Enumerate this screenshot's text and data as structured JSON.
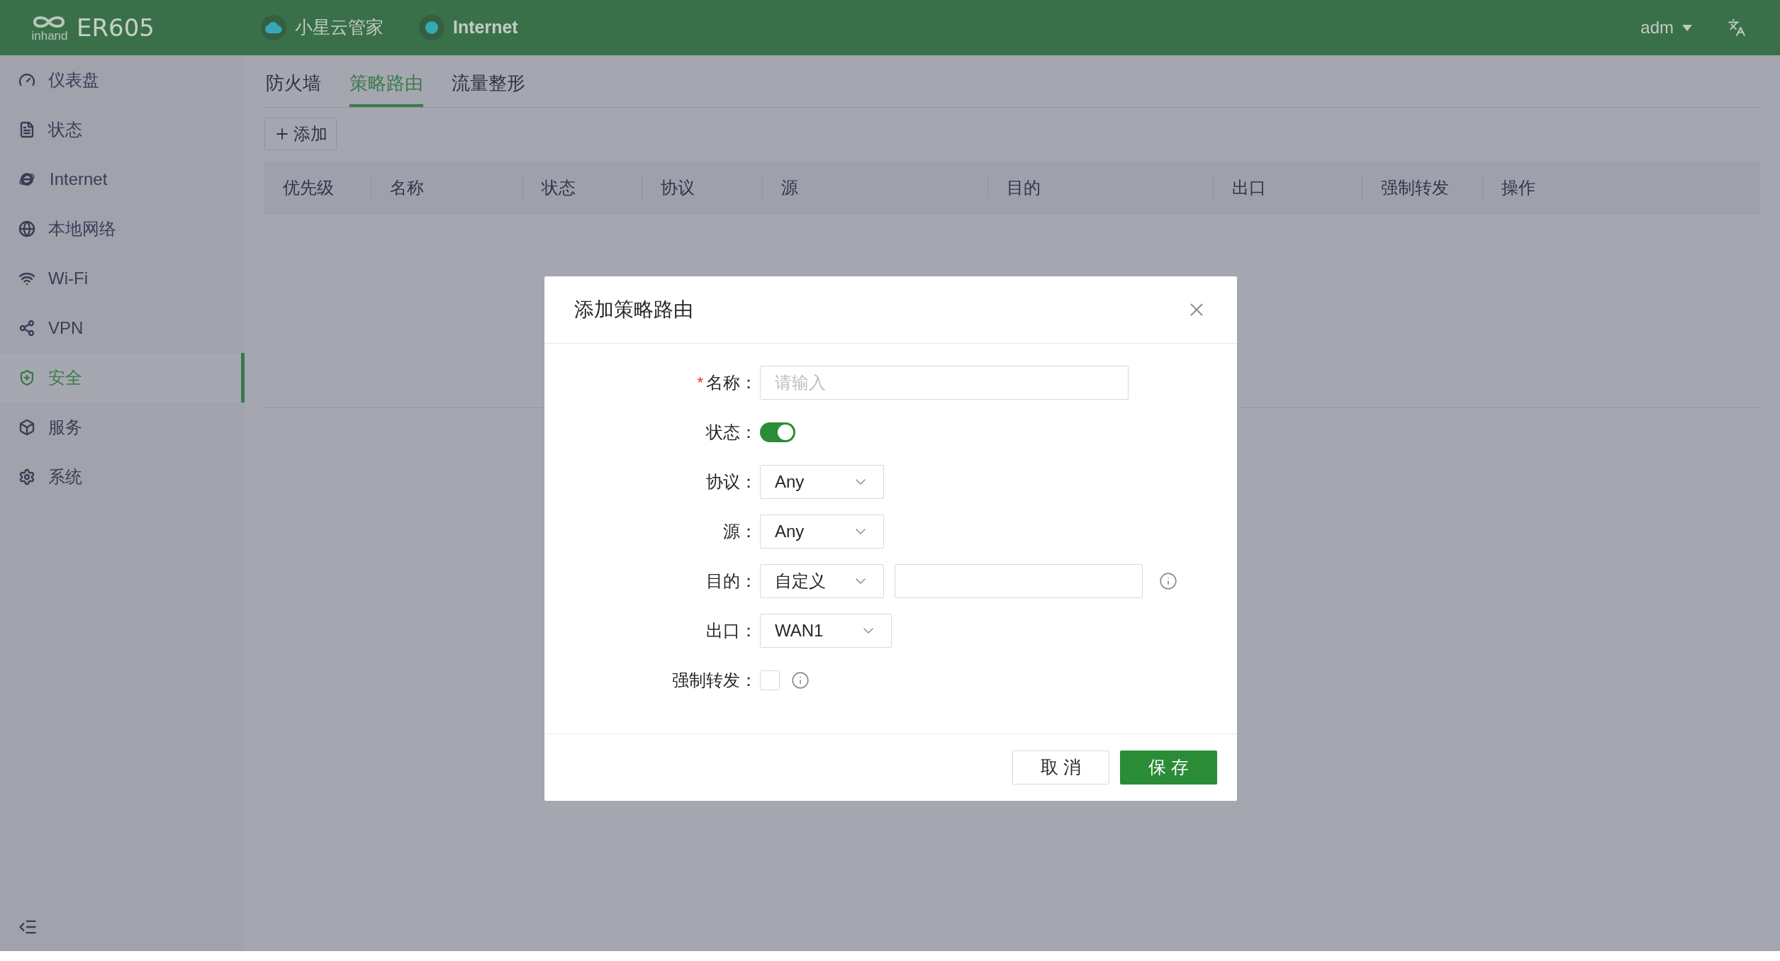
{
  "topbar": {
    "brand": "inhand",
    "model": "ER605",
    "status": [
      {
        "kind": "cloud",
        "label": "小星云管家"
      },
      {
        "kind": "dot",
        "label": "Internet"
      }
    ],
    "user": "adm"
  },
  "sidebar": {
    "items": [
      {
        "kind": "gauge",
        "label": "仪表盘",
        "selected": false
      },
      {
        "kind": "doc",
        "label": "状态",
        "selected": false
      },
      {
        "kind": "ie",
        "label": "Internet",
        "selected": false
      },
      {
        "kind": "globe",
        "label": "本地网络",
        "selected": false
      },
      {
        "kind": "wifi",
        "label": "Wi-Fi",
        "selected": false
      },
      {
        "kind": "vpn",
        "label": "VPN",
        "selected": false
      },
      {
        "kind": "shield",
        "label": "安全",
        "selected": true
      },
      {
        "kind": "box",
        "label": "服务",
        "selected": false
      },
      {
        "kind": "gear",
        "label": "系统",
        "selected": false
      }
    ]
  },
  "tabs": [
    {
      "label": "防火墙",
      "selected": false
    },
    {
      "label": "策略路由",
      "selected": true
    },
    {
      "label": "流量整形",
      "selected": false
    }
  ],
  "add_button": "添加",
  "table": {
    "columns": [
      "优先级",
      "名称",
      "状态",
      "协议",
      "源",
      "目的",
      "出口",
      "强制转发",
      "操作"
    ]
  },
  "dialog": {
    "title": "添加策略路由",
    "fields": [
      {
        "kind": "text",
        "label": "名称：",
        "required_mark": "*",
        "placeholder": "请输入"
      },
      {
        "kind": "switch",
        "label": "状态：",
        "on": true
      },
      {
        "kind": "select",
        "label": "协议：",
        "value": "Any"
      },
      {
        "kind": "select",
        "label": "源：",
        "value": "Any"
      },
      {
        "kind": "select_input",
        "label": "目的：",
        "value": "自定义"
      },
      {
        "kind": "select",
        "label": "出口：",
        "value": "WAN1"
      },
      {
        "kind": "checkbox",
        "label": "强制转发：",
        "checked": false
      }
    ],
    "buttons": [
      {
        "kind": "secondary",
        "label": "取 消"
      },
      {
        "kind": "primary",
        "label": "保 存"
      }
    ]
  }
}
